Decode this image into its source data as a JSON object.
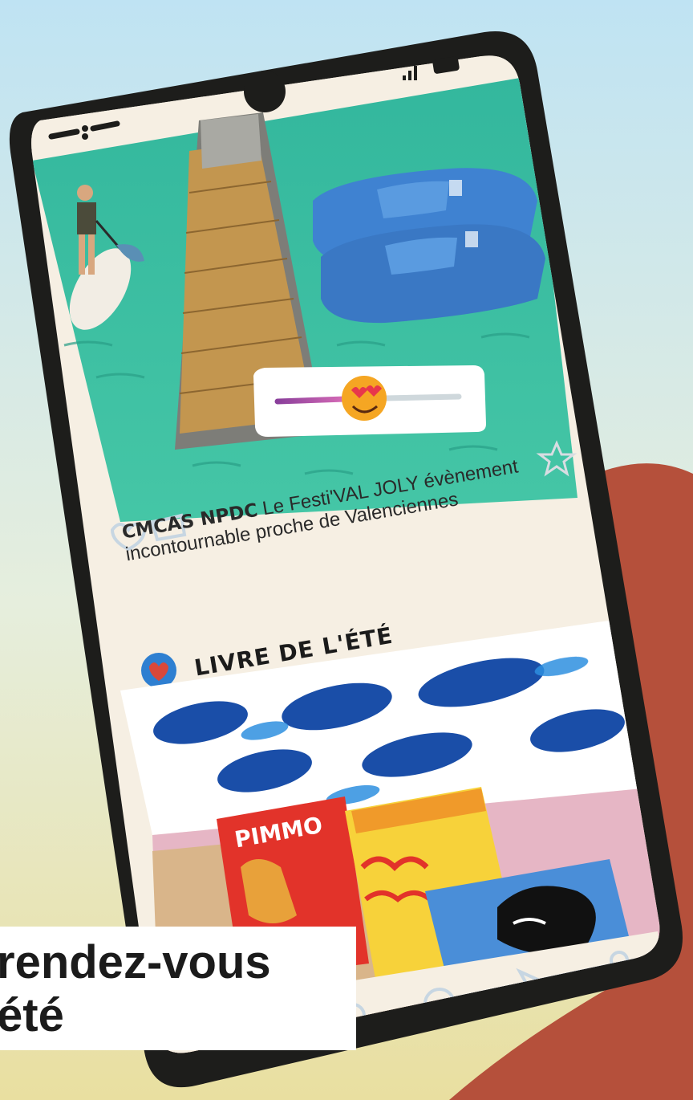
{
  "caption": {
    "line1": "rendez-vous",
    "line2": "été"
  },
  "post": {
    "brand": "CMCAS NPDC",
    "text": "Le Festi'VAL JOLY évènement incontournable proche de Valenciennes"
  },
  "section": {
    "title": "LIVRE DE L'ÉTÉ"
  },
  "book": {
    "cover_text": "PIMMO"
  },
  "reaction_slider": {
    "value": 0.45,
    "emoji": "heart-eyes-emoji"
  },
  "icons": [
    "menu-icon",
    "signal-icon",
    "battery-icon",
    "heart-icon",
    "like-icon",
    "star-icon",
    "search-icon",
    "compass-icon",
    "send-icon",
    "profile-icon"
  ],
  "colors": {
    "sky_top": "#bfe3f3",
    "sand": "#eae2a6",
    "phone_frame": "#1d1d1b",
    "lake": "#3bbd9f",
    "boats": "#3f82d1",
    "hand": "#b5503b",
    "screen_bg": "#f6efe3"
  }
}
